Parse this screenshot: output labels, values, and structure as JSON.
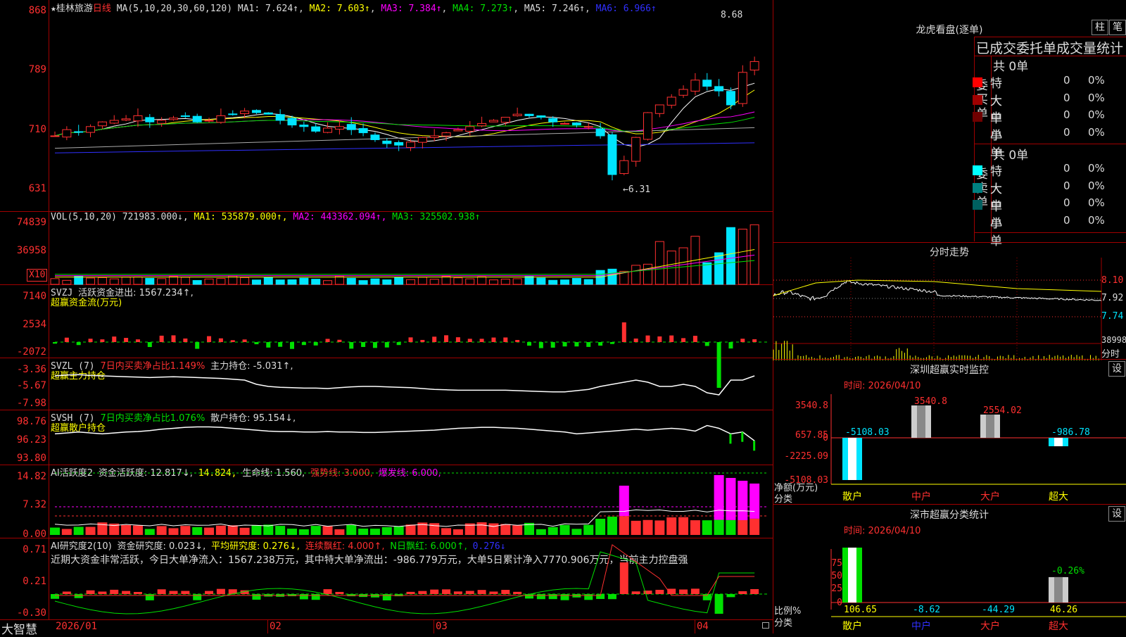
{
  "stock": {
    "star": "★",
    "name": "桂林旅游",
    "period": "日线"
  },
  "main": {
    "ma_label": "MA(5,10,20,30,60,120)",
    "ma1": "MA1: 7.624↑",
    "ma2": "MA2: 7.603↑",
    "ma3": "MA3: 7.384↑",
    "ma4": "MA4: 7.273↑",
    "ma5": "MA5: 7.246↑",
    "ma6": "MA6: 6.966↑",
    "y_labels": [
      "868",
      "789",
      "710",
      "631"
    ],
    "high_label": "8.68",
    "low_label": "←6.31"
  },
  "vol": {
    "label": "VOL(5,10,20)",
    "value": "721983.000↓,",
    "ma1": "MA1: 535879.000↑,",
    "ma2": "MA2: 443362.094↑,",
    "ma3": "MA3: 325502.938↑",
    "y_labels": [
      "74839",
      "36958"
    ],
    "unit": "X10"
  },
  "svzj": {
    "label": "SVZJ",
    "text": "活跃资金进出: 1567.234↑,",
    "sub": "超赢资金流(万元)",
    "y_labels": [
      "7140",
      "2534",
      "-2072"
    ]
  },
  "svzl": {
    "label": "SVZL (7)",
    "text1": "7日内买卖净占比1.149%",
    "text2": "主力持仓: -5.031↑,",
    "sub": "超赢主力持仓",
    "y_labels": [
      "-3.36",
      "-5.67",
      "-7.98"
    ]
  },
  "svsh": {
    "label": "SVSH (7)",
    "text1": "7日内买卖净占比1.076%",
    "text2": "散户持仓: 95.154↓,",
    "sub": "超赢散户持仓",
    "y_labels": [
      "98.76",
      "96.23",
      "93.80"
    ]
  },
  "ai1": {
    "label": "AI活跃度2",
    "t1": "资金活跃度: 12.817↓,",
    "t2": "14.824,",
    "t3": "生命线: 1.560,",
    "t4": "强势线: 3.000,",
    "t5": "爆发线: 6.000,",
    "y_labels": [
      "14.82",
      "7.32",
      "0.00"
    ]
  },
  "ai2": {
    "label": "AI研究度2(10)",
    "t1": "资金研究度: 0.023↓,",
    "t2": "平均研究度: 0.276↓,",
    "t3": "连续飘红: 4.000↑,",
    "t4": "N日飘红: 6.000↑,",
    "t5": "0.276↓",
    "summary": "近期大资金非常活跃，今日大单净流入：1567.238万元，其中特大单净流出：-986.779万元，大单5日累计净入7770.906万元，当前主力控盘强",
    "y_labels": [
      "0.71",
      "0.21",
      "-0.30"
    ]
  },
  "xaxis": {
    "brand": "大智慧",
    "labels": [
      "2026/01",
      "02",
      "03",
      "04"
    ]
  },
  "lhb": {
    "title": "龙虎看盘(逐单)",
    "btn1": "柱",
    "btn2": "笔",
    "subtitle": "已成交委托单成交量统计",
    "buy": {
      "side": [
        "委",
        "买",
        "单"
      ],
      "total": "共 0单",
      "rows": [
        {
          "name": "特大",
          "count": "0",
          "pct": "0%",
          "color": "#ff0000"
        },
        {
          "name": "大单",
          "count": "0",
          "pct": "0%",
          "color": "#a00000"
        },
        {
          "name": "中单",
          "count": "0",
          "pct": "0%",
          "color": "#700000"
        },
        {
          "name": "小单",
          "count": "0",
          "pct": "0%",
          "color": ""
        }
      ]
    },
    "sell": {
      "side": [
        "委",
        "卖",
        "单"
      ],
      "total": "共 0单",
      "rows": [
        {
          "name": "特大",
          "count": "0",
          "pct": "0%",
          "color": "#00ffff"
        },
        {
          "name": "大单",
          "count": "0",
          "pct": "0%",
          "color": "#008080"
        },
        {
          "name": "中单",
          "count": "0",
          "pct": "0%",
          "color": "#006060"
        },
        {
          "name": "小单",
          "count": "0",
          "pct": "0%",
          "color": ""
        }
      ]
    }
  },
  "intraday": {
    "title": "分时走势",
    "y_labels": [
      "8.10",
      "7.92",
      "7.74"
    ],
    "vol_label": "38998",
    "unit": "分时"
  },
  "monitor": {
    "title": "深圳超赢实时监控",
    "btn": "设",
    "time": "时间: 2026/04/10",
    "y_labels": [
      "3540.8",
      "657.85",
      "0",
      "-2225.09",
      "-5108.03"
    ],
    "unit": "净额(万元)",
    "cat_label": "分类",
    "cats": [
      "散户",
      "中户",
      "大户",
      "超大"
    ],
    "values": [
      "-5108.03",
      "3540.8",
      "2554.02",
      "-986.78"
    ]
  },
  "classify": {
    "title": "深市超赢分类统计",
    "btn": "设",
    "time": "时间: 2026/04/10",
    "y_labels": [
      "75",
      "50",
      "25",
      "0"
    ],
    "unit": "比例%",
    "cat_label": "分类",
    "cats": [
      "散户",
      "中户",
      "大户",
      "超大"
    ],
    "values": [
      "106.65",
      "-8.62",
      "-44.29",
      "46.26"
    ],
    "top_label": "-0.26%"
  }
}
